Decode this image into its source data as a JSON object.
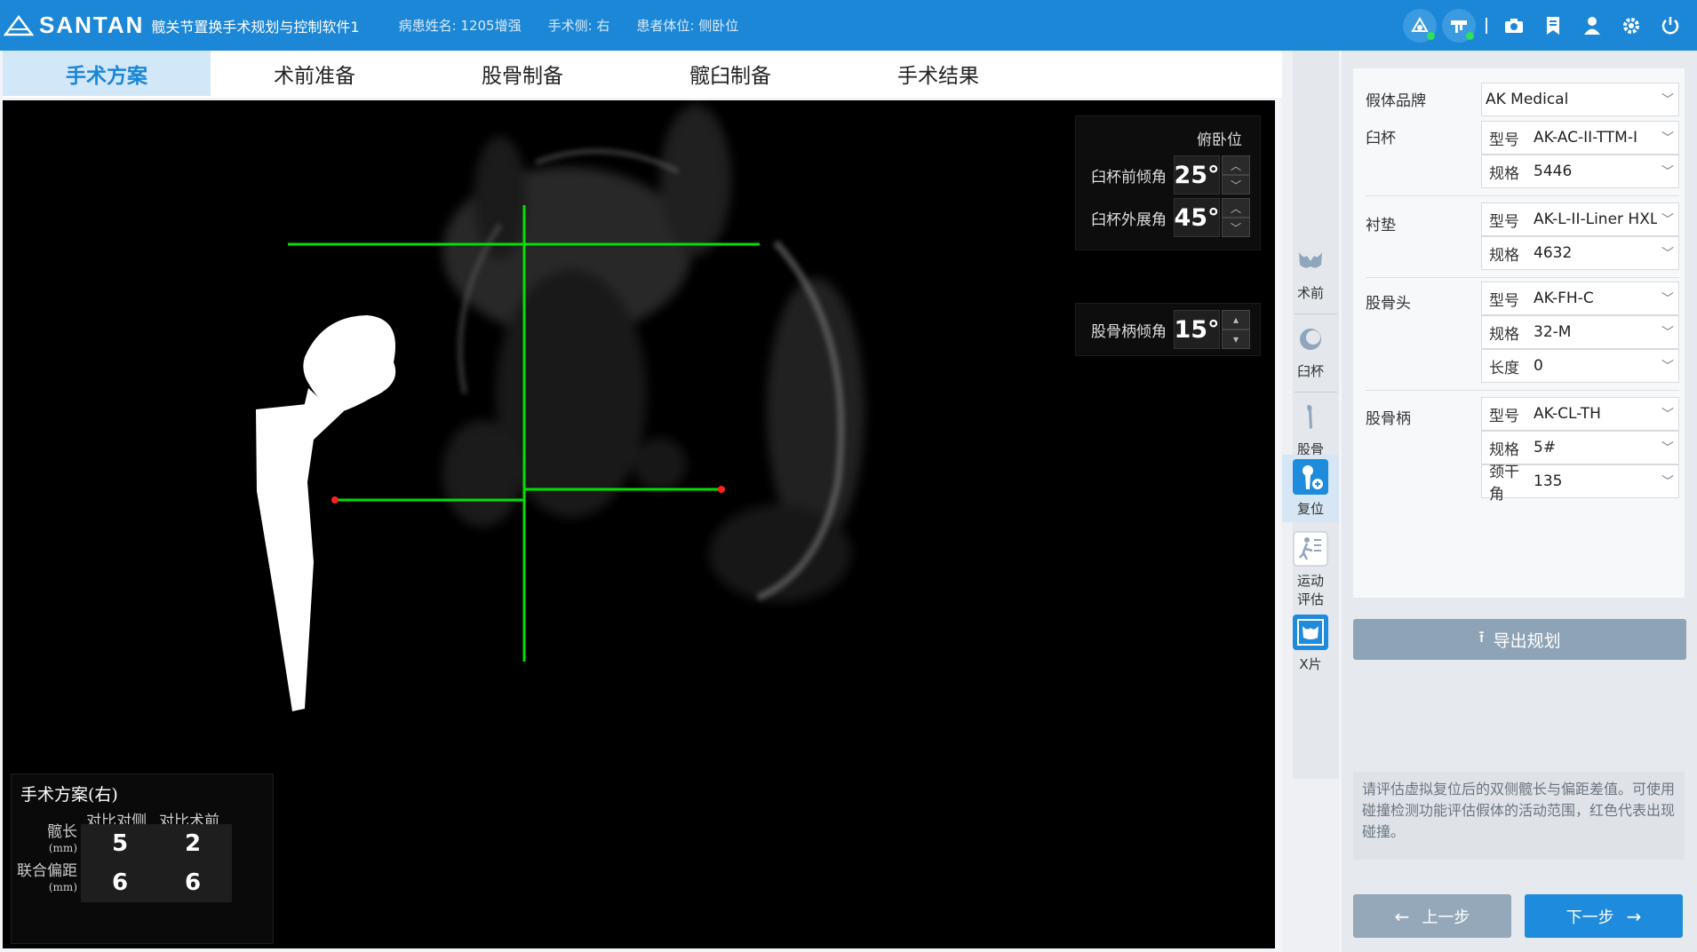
{
  "app": {
    "brand": "SANTAN",
    "title": "髋关节置换手术规划与控制软件1",
    "patient": "病患姓名: 1205增强",
    "side": "手术侧: 右",
    "position": "患者体位: 侧卧位"
  },
  "top_icons": [
    "robot-status-icon",
    "navigation-device-icon",
    "camera-icon",
    "bookmark-icon",
    "user-icon",
    "settings-icon",
    "power-icon"
  ],
  "tabs": [
    {
      "label": "手术方案",
      "active": true
    },
    {
      "label": "术前准备"
    },
    {
      "label": "股骨制备"
    },
    {
      "label": "髋臼制备"
    },
    {
      "label": "手术结果"
    }
  ],
  "viewer": {
    "angle_panel": {
      "header": "俯卧位",
      "cup_anteversion_label": "臼杯前倾角",
      "cup_anteversion_value": "25°",
      "cup_abduction_label": "臼杯外展角",
      "cup_abduction_value": "45°"
    },
    "stem_panel": {
      "label": "股骨柄倾角",
      "value": "15°"
    },
    "result": {
      "title": "手术方案(右)",
      "col1": "对比对侧",
      "col2": "对比术前",
      "row1_label": "髋长",
      "row1_unit": "(mm)",
      "row1_v1": "5",
      "row1_v2": "2",
      "row2_label": "联合偏距",
      "row2_unit": "(mm)",
      "row2_v1": "6",
      "row2_v2": "6"
    }
  },
  "sidebar": {
    "items": [
      {
        "label": "术前",
        "icon": "pelvis-icon"
      },
      {
        "label": "臼杯",
        "icon": "cup-icon"
      },
      {
        "label": "股骨",
        "icon": "femur-icon"
      },
      {
        "label": "复位",
        "icon": "reduction-icon",
        "selected": true
      },
      {
        "label": "运动",
        "label2": "评估",
        "icon": "motion-eval-icon"
      },
      {
        "label": "X片",
        "icon": "xray-icon"
      }
    ]
  },
  "implant": {
    "brand_label": "假体品牌",
    "brand_value": "AK Medical",
    "cup_label": "臼杯",
    "cup_model_key": "型号",
    "cup_model": "AK-AC-II-TTM-I",
    "cup_size_key": "规格",
    "cup_size": "5446",
    "liner_label": "衬垫",
    "liner_model_key": "型号",
    "liner_model": "AK-L-II-Liner HXL",
    "liner_size_key": "规格",
    "liner_size": "4632",
    "head_label": "股骨头",
    "head_model_key": "型号",
    "head_model": "AK-FH-C",
    "head_size_key": "规格",
    "head_size": "32-M",
    "head_len_key": "长度",
    "head_len": "0",
    "stem_label": "股骨柄",
    "stem_model_key": "型号",
    "stem_model": "AK-CL-TH",
    "stem_size_key": "规格",
    "stem_size": "5#",
    "stem_angle_key": "颈干角",
    "stem_angle": "135"
  },
  "export_label": "导出规划",
  "hint_text": "请评估虚拟复位后的双侧髋长与偏距差值。可使用碰撞检测功能评估假体的活动范围，红色代表出现碰撞。",
  "prev_label": "上一步",
  "next_label": "下一步",
  "colors": {
    "primary": "#1c87d6",
    "overlay_line": "#00e000",
    "marker": "#ff2020"
  }
}
